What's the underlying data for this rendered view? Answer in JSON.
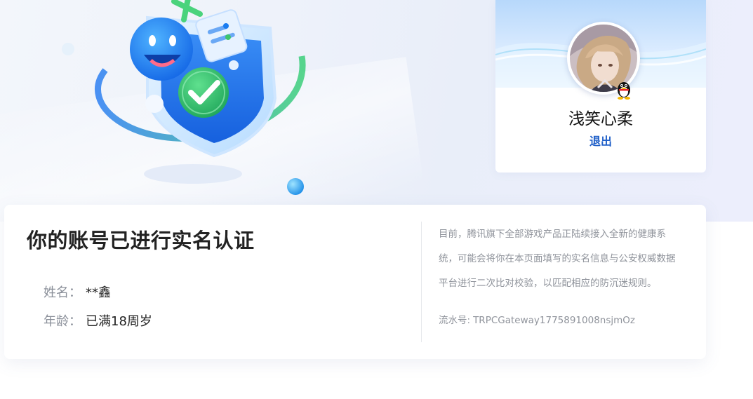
{
  "profile": {
    "username": "浅笑心柔",
    "logout_label": "退出"
  },
  "verification": {
    "title": "你的账号已进行实名认证",
    "name_label": "姓名：",
    "name_value": "**鑫",
    "age_label": "年龄：",
    "age_value": "已满18周岁"
  },
  "notice": {
    "text": "目前，腾讯旗下全部游戏产品正陆续接入全新的健康系统，可能会将你在本页面填写的实名信息与公安权威数据平台进行二次比对校验，以匹配相应的防沉迷规则。",
    "serial_label": "流水号:",
    "serial_value": "TRPCGateway1775891008nsjmOz"
  },
  "colors": {
    "accent": "#1f5fc8",
    "title": "#222222",
    "muted": "#8f939b",
    "shield_green": "#3ec46d",
    "shield_blue": "#1a7cf0"
  },
  "icons": {
    "illustration": "shield-check-illustration",
    "qq": "qq-penguin-icon"
  }
}
